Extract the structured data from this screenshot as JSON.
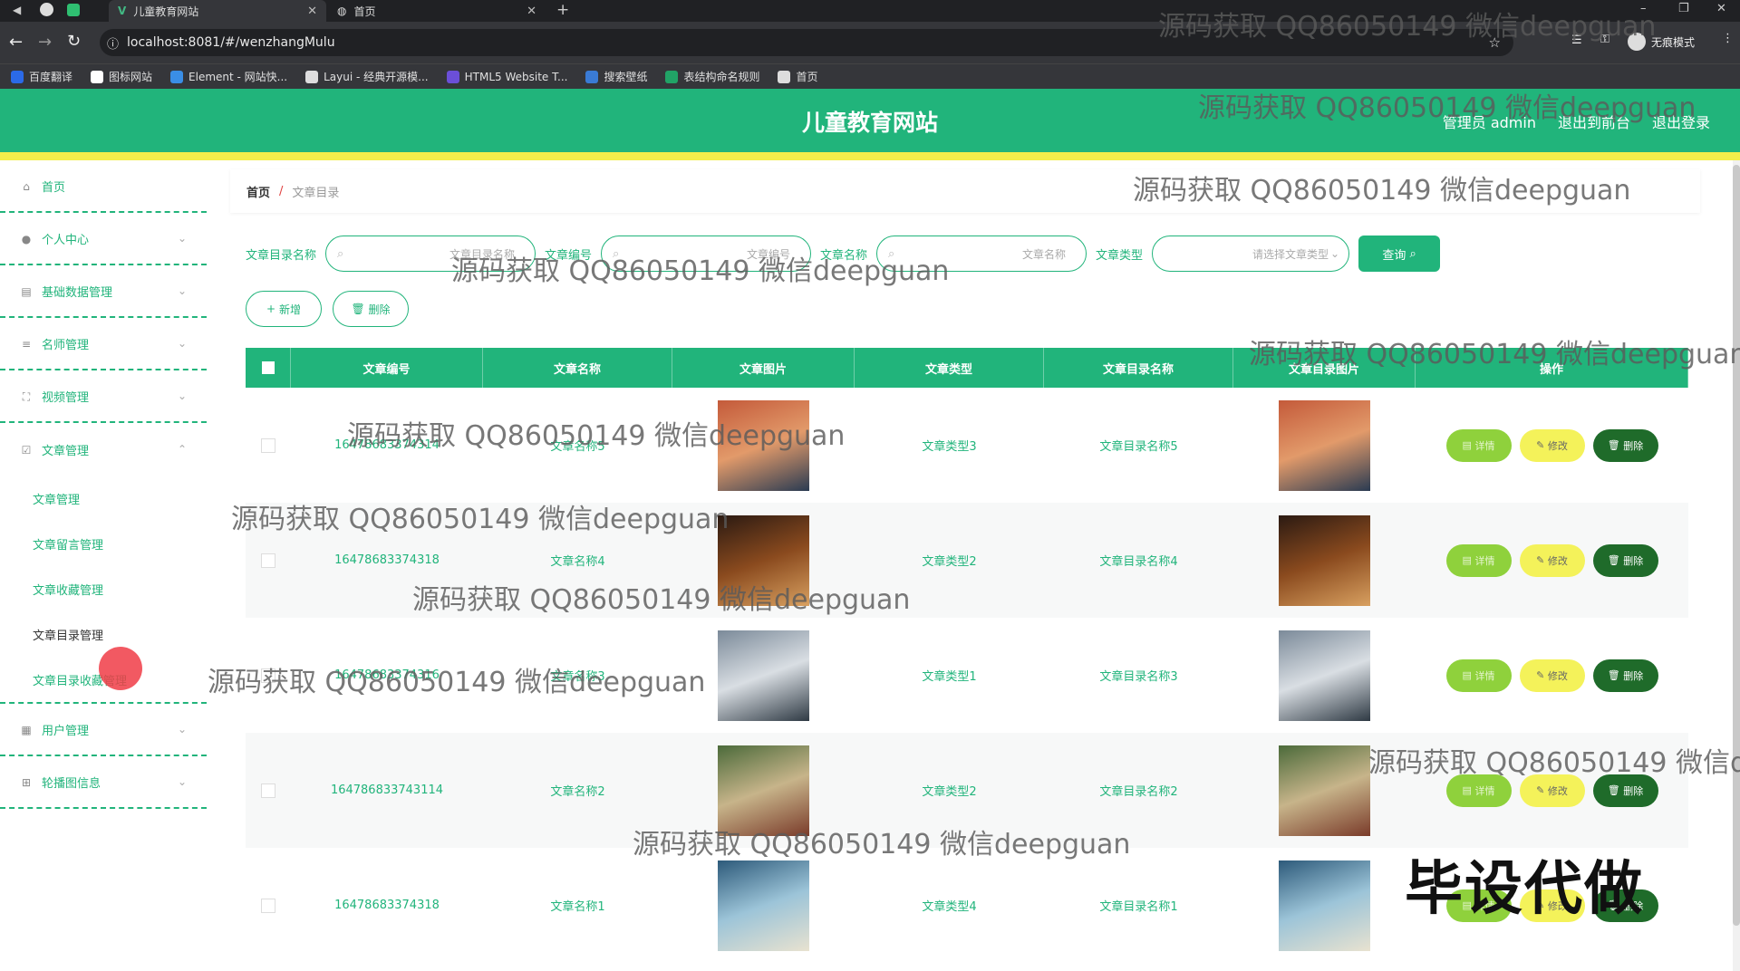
{
  "browser": {
    "tabs": [
      {
        "title": "儿童教育网站",
        "active": true
      },
      {
        "title": "首页",
        "active": false
      }
    ],
    "new_tab": "+",
    "url": "localhost:8081/#/wenzhangMulu",
    "profile_label": "无痕模式",
    "bookmarks": [
      {
        "label": "百度翻译",
        "color": "#2b6ae8"
      },
      {
        "label": "图标网站",
        "color": "#ffffff"
      },
      {
        "label": "Element - 网站快...",
        "color": "#3a8ee6"
      },
      {
        "label": "Layui - 经典开源模...",
        "color": "#dddddd"
      },
      {
        "label": "HTML5 Website T...",
        "color": "#6b4fd8"
      },
      {
        "label": "搜索壁纸",
        "color": "#3a7bd5"
      },
      {
        "label": "表结构命名规则",
        "color": "#21a366"
      },
      {
        "label": "首页",
        "color": "#dddddd"
      }
    ]
  },
  "header": {
    "title": "儿童教育网站",
    "admin": "管理员 admin",
    "to_front": "退出到前台",
    "logout": "退出登录"
  },
  "colors": {
    "primary": "#21b47b",
    "accent_bar": "#f2ee4b",
    "detail": "#8fd13c",
    "edit": "#f4f25a",
    "delete": "#1f6b2a"
  },
  "sidebar": {
    "menus": [
      {
        "label": "首页",
        "icon": "home-icon"
      },
      {
        "label": "个人中心",
        "icon": "user-icon"
      },
      {
        "label": "基础数据管理",
        "icon": "chat-icon"
      },
      {
        "label": "名师管理",
        "icon": "list-icon"
      },
      {
        "label": "视频管理",
        "icon": "fullscreen-icon"
      },
      {
        "label": "文章管理",
        "icon": "checkbox-icon"
      }
    ],
    "submenus": [
      "文章管理",
      "文章留言管理",
      "文章收藏管理",
      "文章目录管理",
      "文章目录收藏管理"
    ],
    "menus_after": [
      {
        "label": "用户管理",
        "icon": "users-icon"
      },
      {
        "label": "轮播图信息",
        "icon": "grid-icon"
      }
    ]
  },
  "breadcrumb": {
    "home": "首页",
    "sep": "/",
    "current": "文章目录"
  },
  "search": {
    "label1": "文章目录名称",
    "placeholder1": "文章目录名称",
    "label2": "文章编号",
    "placeholder2": "文章编号",
    "label3": "文章名称",
    "placeholder3": "文章名称",
    "label4": "文章类型",
    "placeholder4": "请选择文章类型",
    "query": "查询"
  },
  "actions": {
    "add": "新增",
    "delete": "删除"
  },
  "table": {
    "columns": [
      "文章编号",
      "文章名称",
      "文章图片",
      "文章类型",
      "文章目录名称",
      "文章目录图片",
      "操作"
    ],
    "rows": [
      {
        "id": "16478683374314",
        "name": "文章名称5",
        "type": "文章类型3",
        "dir": "文章目录名称5"
      },
      {
        "id": "16478683374318",
        "name": "文章名称4",
        "type": "文章类型2",
        "dir": "文章目录名称4"
      },
      {
        "id": "16478683374316",
        "name": "文章名称3",
        "type": "文章类型1",
        "dir": "文章目录名称3"
      },
      {
        "id": "164786833743114",
        "name": "文章名称2",
        "type": "文章类型2",
        "dir": "文章目录名称2"
      },
      {
        "id": "16478683374318",
        "name": "文章名称1",
        "type": "文章类型4",
        "dir": "文章目录名称1"
      }
    ],
    "ops": {
      "detail": "详情",
      "edit": "修改",
      "delete": "删除"
    }
  },
  "watermark": "源码获取 QQ86050149 微信deepguan",
  "stamp": "毕设代做"
}
